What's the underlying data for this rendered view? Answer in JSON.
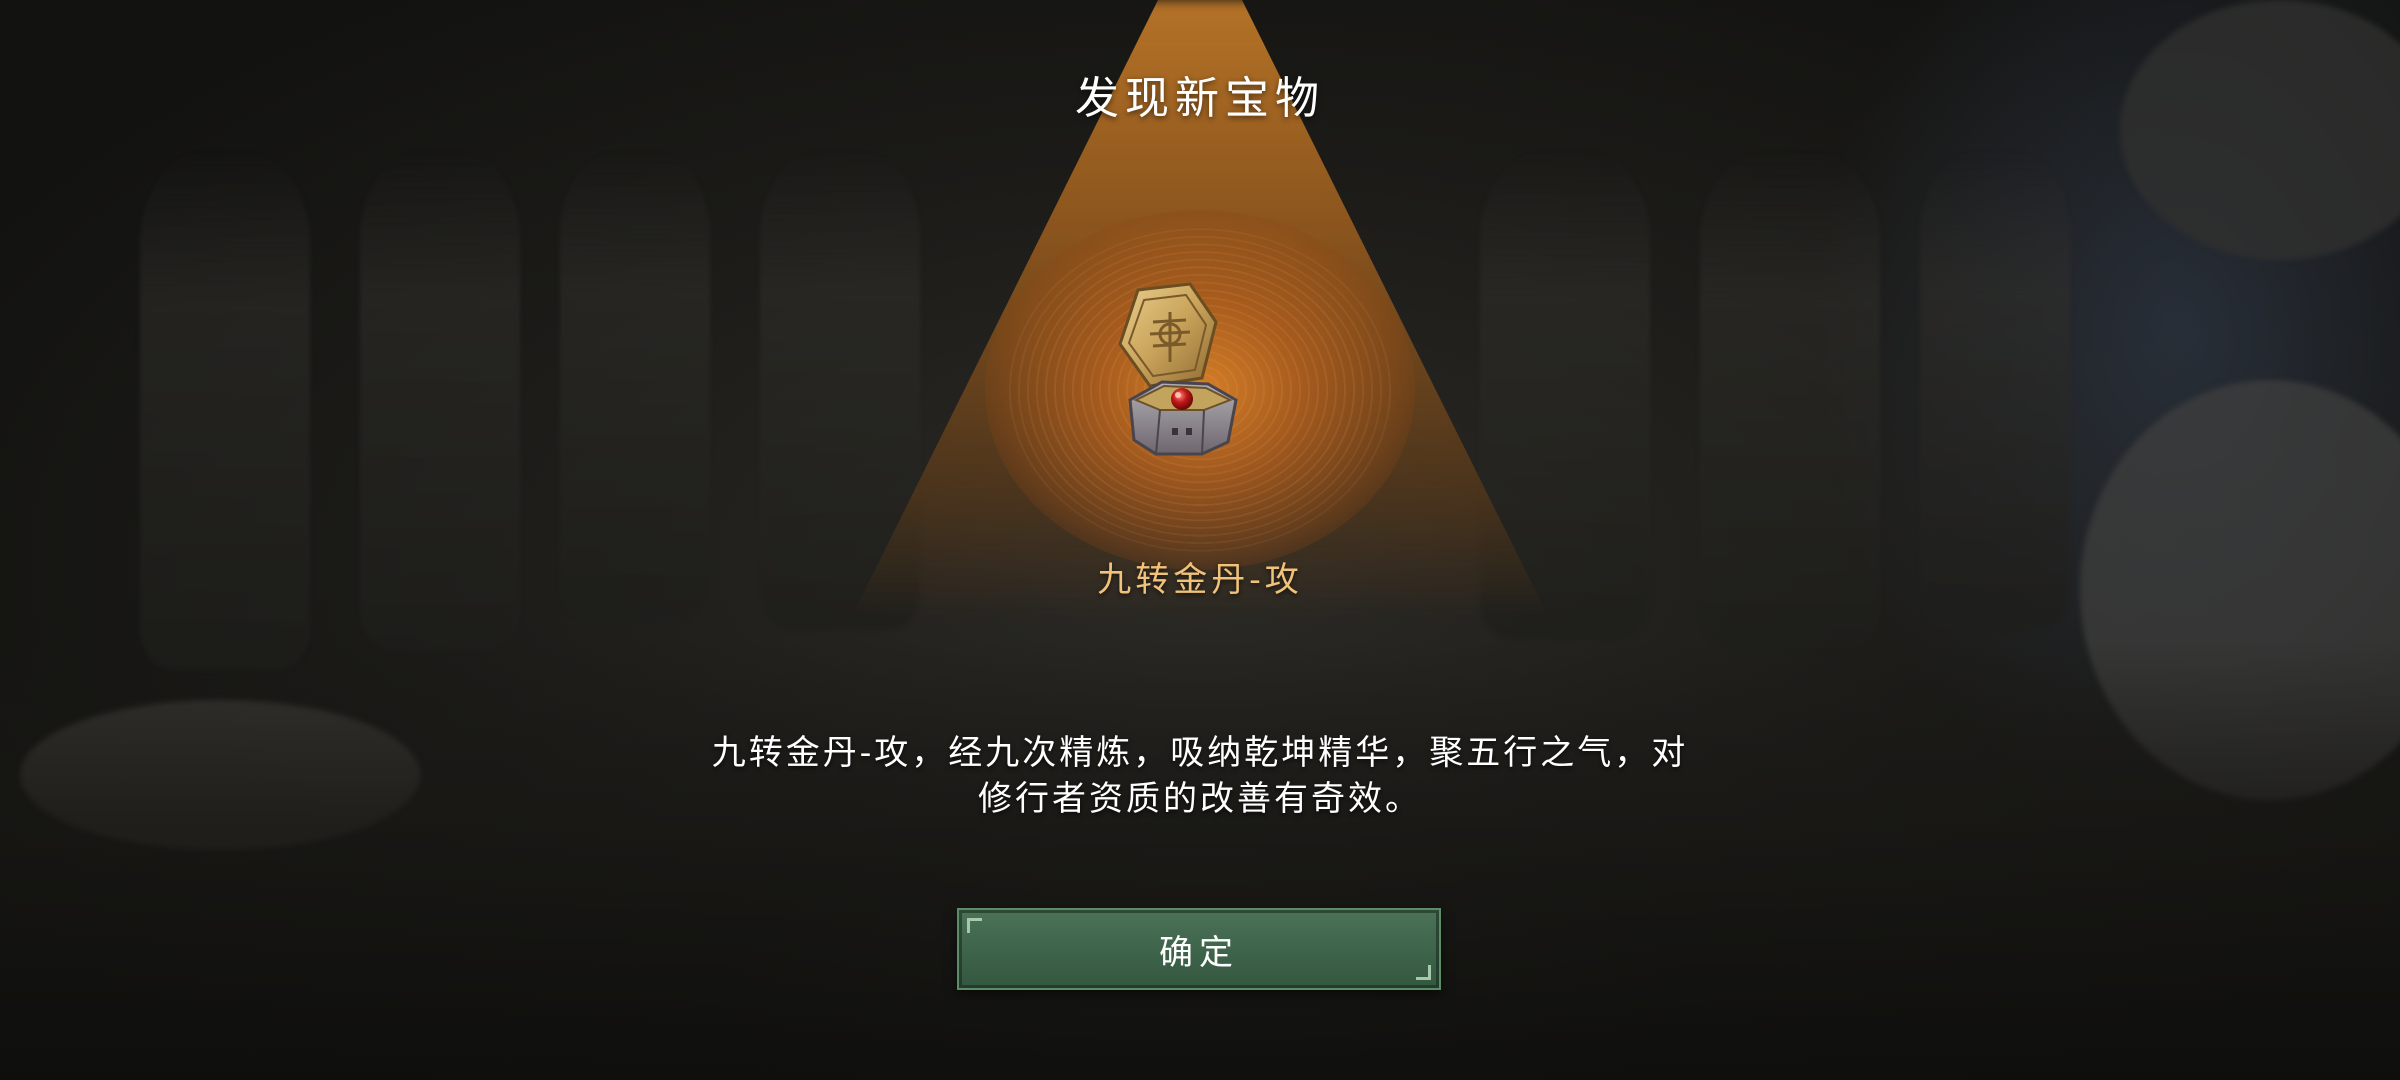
{
  "screen": {
    "title": "发现新宝物",
    "item": {
      "icon": "treasure-box-icon",
      "name": "九转金丹-攻"
    },
    "description": "九转金丹-攻，经九次精炼，吸纳乾坤精华，聚五行之气，对修行者资质的改善有奇效。",
    "confirm_label": "确定"
  },
  "colors": {
    "item_name": "#f1c27a",
    "button_fill": "#3d634a",
    "button_border": "#5d8c69",
    "light_beam": "#be7828"
  }
}
